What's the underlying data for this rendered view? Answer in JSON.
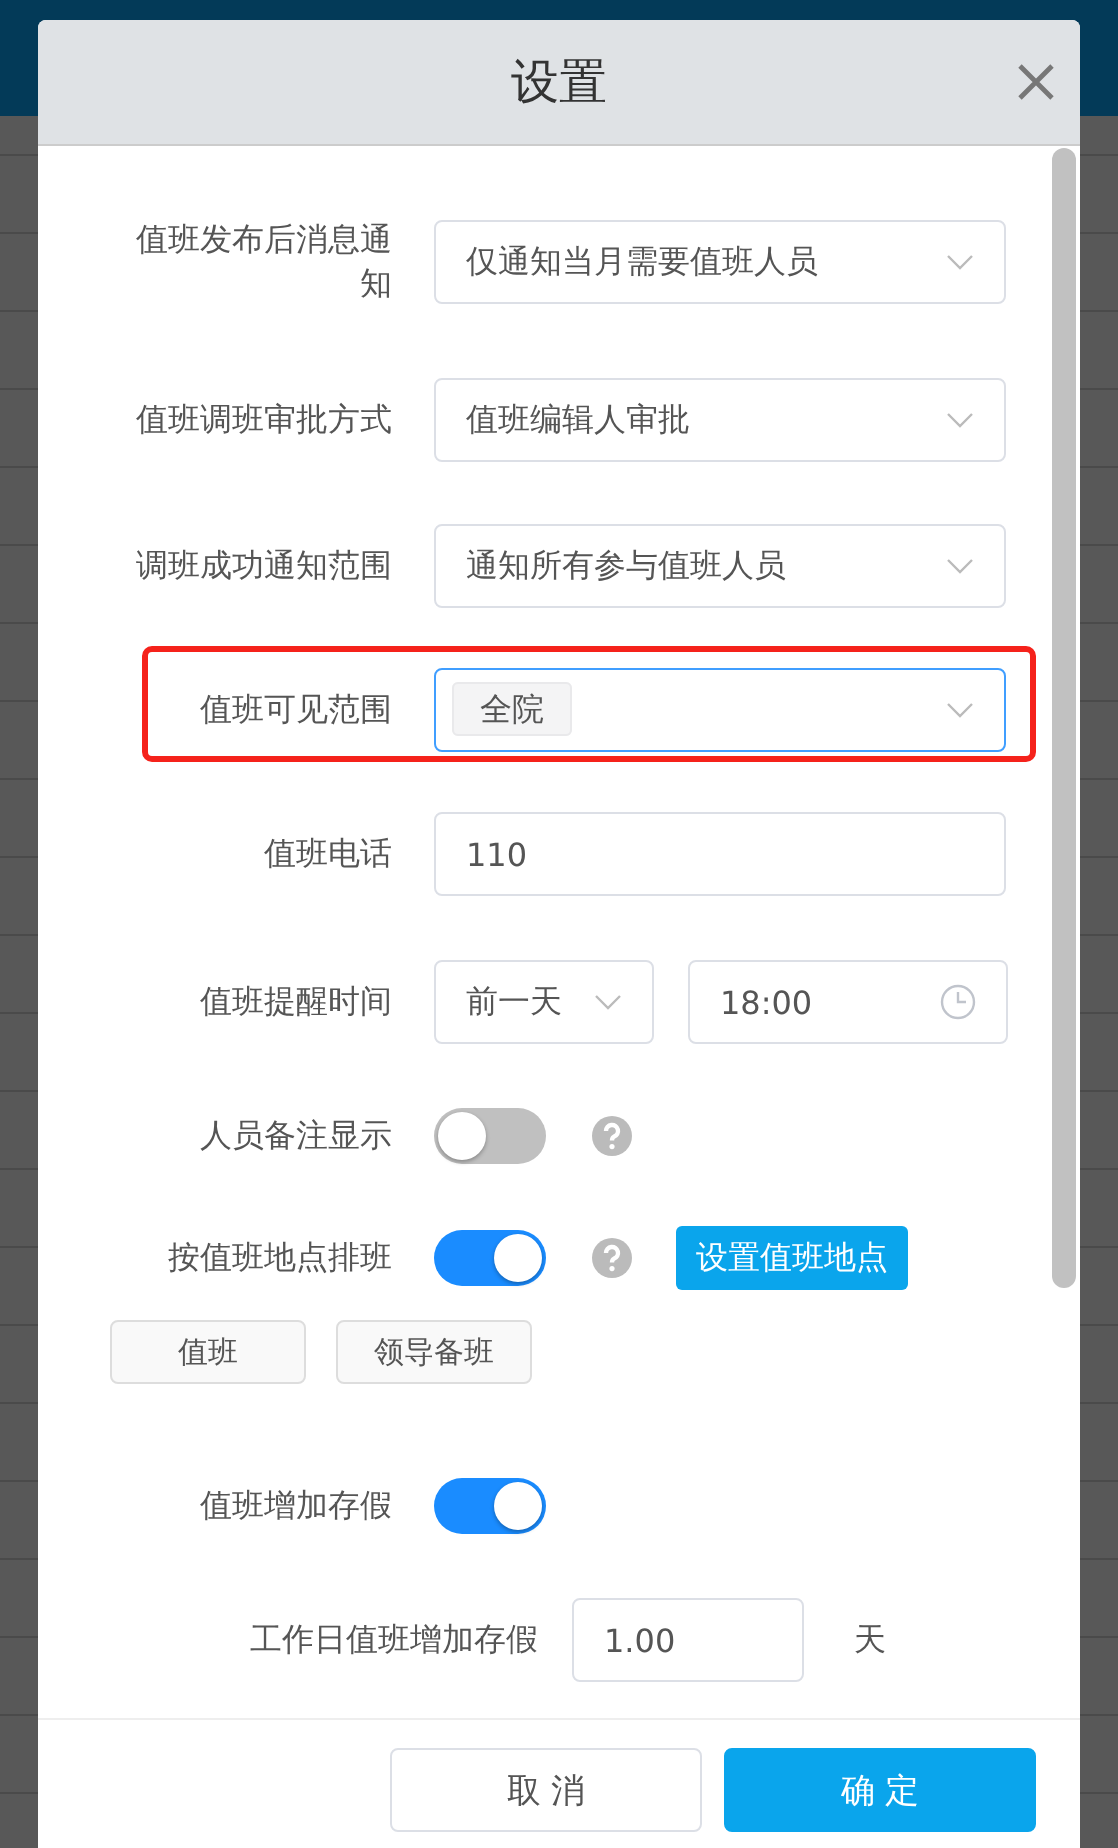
{
  "title": "设置",
  "fields": [
    {
      "kind": "select",
      "label": "值班发布后消息通知",
      "value": "仅通知当月需要值班人员"
    },
    {
      "kind": "select",
      "label": "值班调班审批方式",
      "value": "值班编辑人审批"
    },
    {
      "kind": "select",
      "label": "调班成功通知范围",
      "value": "通知所有参与值班人员"
    },
    {
      "kind": "tags",
      "label": "值班可见范围",
      "tags": [
        "全院"
      ],
      "focused": true,
      "highlighted": true
    },
    {
      "kind": "text",
      "label": "值班电话",
      "value": "110"
    },
    {
      "kind": "time",
      "label": "值班提醒时间",
      "value": "前一天",
      "time": "18:00"
    },
    {
      "kind": "switch",
      "label": "人员备注显示",
      "on": false,
      "help": true
    },
    {
      "kind": "switch",
      "label": "按值班地点排班",
      "on": true,
      "help": true,
      "action": "设置值班地点"
    },
    {
      "kind": "chips",
      "chips": [
        "值班",
        "领导备班"
      ]
    },
    {
      "kind": "switch",
      "label": "值班增加存假",
      "on": true
    },
    {
      "kind": "number",
      "label": "工作日值班增加存假",
      "value": "1.00",
      "unit": "天"
    }
  ],
  "buttons": [
    {
      "label": "取 消",
      "primary": false
    },
    {
      "label": "确 定",
      "primary": true
    }
  ]
}
